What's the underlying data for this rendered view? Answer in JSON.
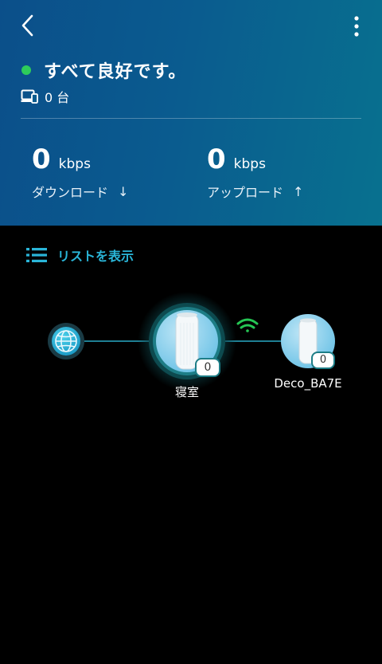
{
  "colors": {
    "status_ok": "#2ecc5a",
    "accent": "#2ab5d8",
    "wifi_signal": "#25c654",
    "line": "#1e7f94"
  },
  "header": {
    "back_icon": "chevron-left-icon",
    "more_icon": "more-vertical-icon",
    "status_text": "すべて良好です。",
    "device_icon": "devices-icon",
    "device_count": "0 台"
  },
  "stats": {
    "download": {
      "value": "0",
      "unit": "kbps",
      "label": "ダウンロード",
      "arrow": "↓"
    },
    "upload": {
      "value": "0",
      "unit": "kbps",
      "label": "アップロード",
      "arrow": "↑"
    }
  },
  "list_toggle": {
    "icon": "list-icon",
    "label": "リストを表示"
  },
  "topology": {
    "internet_icon": "globe-icon",
    "main_node": {
      "name": "寝室",
      "clients": "0"
    },
    "satellite_node": {
      "name": "Deco_BA7E",
      "clients": "0"
    },
    "link_icon": "wifi-icon"
  }
}
